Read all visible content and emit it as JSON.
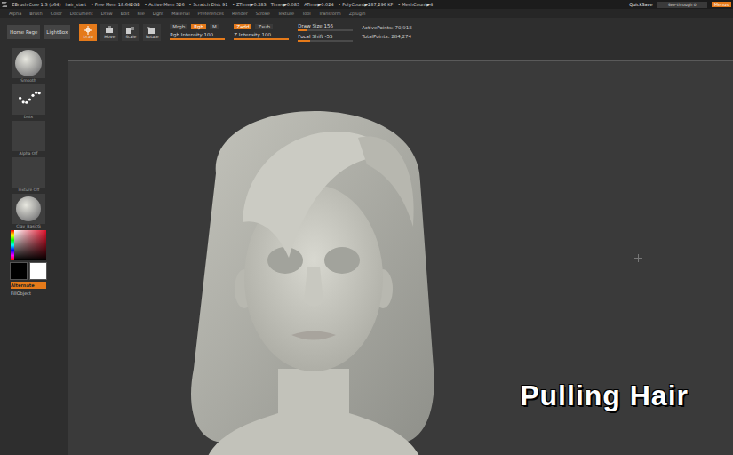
{
  "title_bar": {
    "segments": [
      "ZBrush Core 1.3 (x64)",
      "hair_start",
      "• Free Mem 18.642GB",
      "• Active Mem 526",
      "• Scratch Disk 91",
      "• ZTime▶0.283",
      "Timer▶0.085",
      "ATime▶0.024",
      "• PolyCount▶287,296 KP",
      "• MeshCount▶4"
    ],
    "quicksave": "QuickSave",
    "see_through": {
      "label": "See-through",
      "value": "0",
      "level": 0
    },
    "menus": {
      "label": "Menus",
      "selected": true
    }
  },
  "menu_bar": [
    "Alpha",
    "Brush",
    "Color",
    "Document",
    "Draw",
    "Edit",
    "File",
    "Light",
    "Material",
    "Preferences",
    "Render",
    "Stroke",
    "Texture",
    "Tool",
    "Transform",
    "Zplugin"
  ],
  "toolbar": {
    "nav": [
      "Home Page",
      "LightBox"
    ],
    "modes": [
      {
        "label": "Draw",
        "kind": "draw",
        "selected": true
      },
      {
        "label": "Move",
        "kind": "move",
        "selected": false
      },
      {
        "label": "Scale",
        "kind": "scale",
        "selected": false
      },
      {
        "label": "Rotate",
        "kind": "rotate",
        "selected": false
      }
    ],
    "color_toggles": [
      {
        "label": "Mrgb",
        "selected": false
      },
      {
        "label": "Rgb",
        "selected": true
      },
      {
        "label": "M",
        "selected": false
      }
    ],
    "rgb_intensity": {
      "label": "Rgb Intensity",
      "value": "100",
      "level": 1
    },
    "z_toggles": [
      {
        "label": "Zadd",
        "selected": true
      },
      {
        "label": "Zsub",
        "selected": false
      }
    ],
    "z_intensity": {
      "label": "Z Intensity",
      "value": "100",
      "level": 1
    },
    "draw_size": {
      "label": "Draw Size",
      "value": "156",
      "level": 0.16
    },
    "focal_shift": {
      "label": "Focal Shift",
      "value": "-55",
      "level": 0.22
    },
    "points": [
      "ActivePoints: 70,918",
      "TotalPoints: 284,274"
    ]
  },
  "shelf": {
    "items": [
      {
        "label": "Smooth",
        "kind": "sphere"
      },
      {
        "label": "Dots",
        "kind": "dots"
      },
      {
        "label": "Alpha Off",
        "kind": "empty"
      },
      {
        "label": "Texture Off",
        "kind": "empty"
      },
      {
        "label": "Clay_BasicG",
        "kind": "material"
      }
    ],
    "swatches": [
      {
        "color": "#000000"
      },
      {
        "color": "#ffffff"
      }
    ],
    "alternate": {
      "label": "Alternate",
      "selected": true
    },
    "fill_object": "FillObject"
  },
  "canvas": {
    "caption": "Pulling Hair"
  }
}
